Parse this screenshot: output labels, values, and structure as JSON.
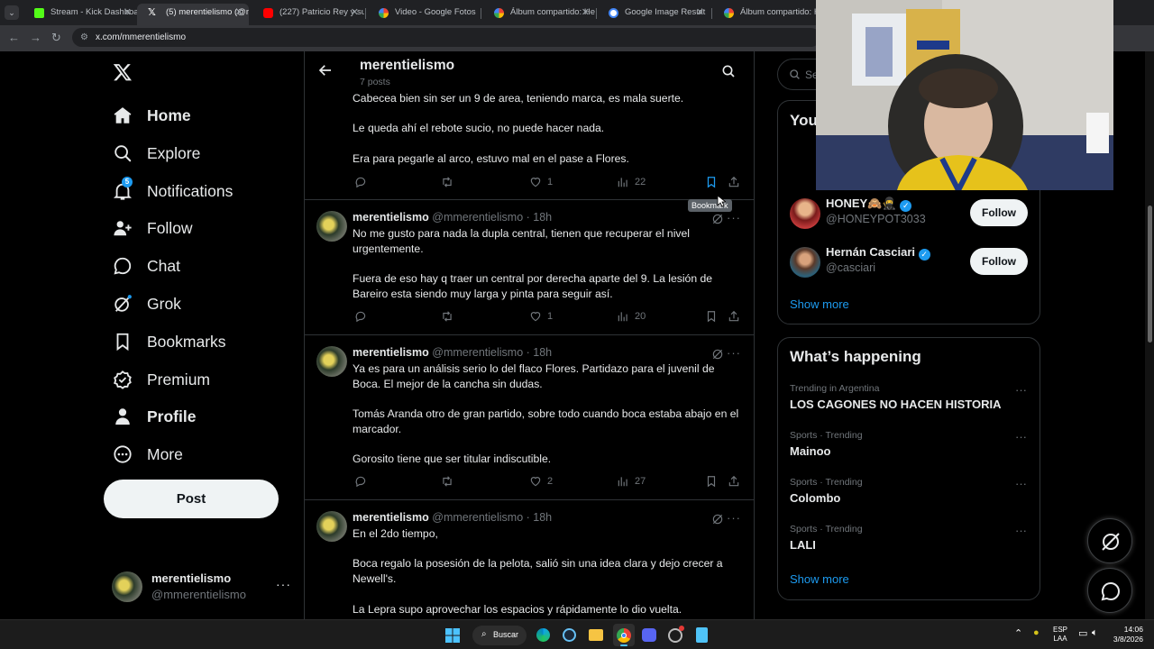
{
  "browser": {
    "tabs": [
      {
        "label": "Stream - Kick Dashboa",
        "color": "#53fc18"
      },
      {
        "label": "(5) merentielismo (@m",
        "color": "#ffffff"
      },
      {
        "label": "(227) Patricio Rey y sus",
        "color": "#ff0000"
      },
      {
        "label": "Video - Google Fotos",
        "color": "#fbbc04"
      },
      {
        "label": "Álbum compartido: He",
        "color": "#fbbc04"
      },
      {
        "label": "Google Image Result",
        "color": "#4285f4"
      },
      {
        "label": "Álbum compartido: He",
        "color": "#fbbc04"
      }
    ],
    "url": "x.com/mmerentielismo"
  },
  "nav": {
    "items": [
      {
        "label": "Home",
        "icon": "home-icon"
      },
      {
        "label": "Explore",
        "icon": "search-icon"
      },
      {
        "label": "Notifications",
        "icon": "bell-icon",
        "badge": "5"
      },
      {
        "label": "Follow",
        "icon": "follow-icon"
      },
      {
        "label": "Chat",
        "icon": "chat-icon"
      },
      {
        "label": "Grok",
        "icon": "grok-icon"
      },
      {
        "label": "Bookmarks",
        "icon": "bookmark-icon"
      },
      {
        "label": "Premium",
        "icon": "premium-icon"
      },
      {
        "label": "Profile",
        "icon": "profile-icon"
      },
      {
        "label": "More",
        "icon": "more-icon"
      }
    ],
    "post_label": "Post",
    "account": {
      "name": "merentielismo",
      "handle": "@mmerentielismo"
    }
  },
  "profile_header": {
    "title": "merentielismo",
    "subtitle": "7 posts"
  },
  "tweets": [
    {
      "name": "",
      "handle": "",
      "time": "",
      "paragraphs": [
        "Cabecea bien sin ser un 9 de area, teniendo marca, es mala suerte.",
        "Le queda ahí el rebote sucio, no puede hacer nada.",
        "Era para pegarle al arco, estuvo mal en el pase a Flores."
      ],
      "replies": "",
      "retweets": "",
      "likes": "1",
      "views": "22"
    },
    {
      "name": "merentielismo",
      "handle": "@mmerentielismo",
      "time": "· 18h",
      "paragraphs": [
        "No me gusto para nada la dupla central, tienen que recuperar el nivel urgentemente.",
        "Fuera de eso hay q traer un central por derecha aparte del 9. La lesión de Bareiro esta siendo muy larga y pinta para seguir así."
      ],
      "replies": "",
      "retweets": "",
      "likes": "1",
      "views": "20"
    },
    {
      "name": "merentielismo",
      "handle": "@mmerentielismo",
      "time": "· 18h",
      "paragraphs": [
        "Ya es para un análisis serio lo del flaco Flores. Partidazo para el juvenil de Boca. El mejor de la cancha sin dudas.",
        "Tomás Aranda otro de gran partido, sobre todo cuando boca estaba abajo en el marcador.",
        "Gorosito tiene que ser titular indiscutible."
      ],
      "replies": "",
      "retweets": "",
      "likes": "2",
      "views": "27"
    },
    {
      "name": "merentielismo",
      "handle": "@mmerentielismo",
      "time": "· 18h",
      "paragraphs": [
        "En el 2do tiempo,",
        "Boca regalo la posesión de la pelota, salió sin una idea clara y dejo crecer a Newell's.",
        "La Lepra supo aprovechar los espacios y rápidamente lo dio vuelta."
      ],
      "replies": "",
      "retweets": "",
      "likes": "",
      "views": ""
    }
  ],
  "tooltip": "Bookmark",
  "right": {
    "search_placeholder": "Search",
    "who_to_follow": {
      "title": "You",
      "accounts": [
        {
          "name": "HONEY🙈🥷",
          "handle": "@HONEYPOT3033",
          "verified": true,
          "button": "Follow"
        },
        {
          "name": "Hernán Casciari",
          "handle": "@casciari",
          "verified": true,
          "button": "Follow"
        }
      ],
      "show_more": "Show more"
    },
    "happening": {
      "title": "What’s happening",
      "trends": [
        {
          "context": "Trending in Argentina",
          "name": "LOS CAGONES NO HACEN HISTORIA"
        },
        {
          "context": "Sports · Trending",
          "name": "Mainoo"
        },
        {
          "context": "Sports · Trending",
          "name": "Colombo"
        },
        {
          "context": "Sports · Trending",
          "name": "LALI"
        }
      ],
      "show_more": "Show more"
    }
  },
  "taskbar": {
    "search_label": "Buscar",
    "lang": "ESP",
    "region": "LAA",
    "time": "14:06",
    "date": "3/8/2026"
  },
  "colors": {
    "accent": "#1d9bf0",
    "bg": "#000000",
    "border": "#2f3336",
    "muted": "#71767b"
  }
}
